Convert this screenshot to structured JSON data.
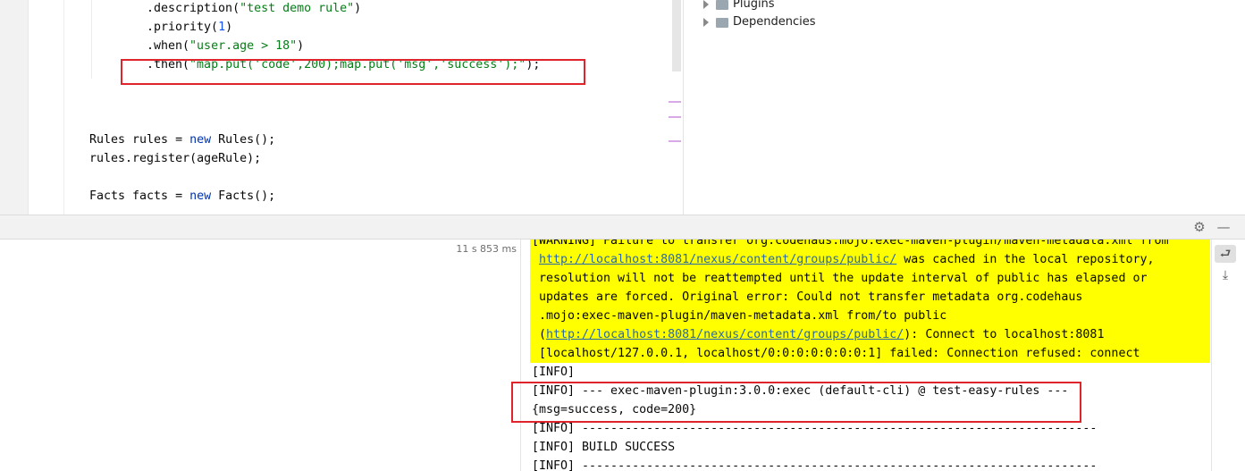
{
  "editor": {
    "lines": [
      {
        "parts": [
          {
            "t": ".description(",
            "c": ""
          },
          {
            "t": "\"test demo rule\"",
            "c": "str"
          },
          {
            "t": ")",
            "c": ""
          }
        ]
      },
      {
        "parts": [
          {
            "t": ".priority(",
            "c": ""
          },
          {
            "t": "1",
            "c": "num"
          },
          {
            "t": ")",
            "c": ""
          }
        ]
      },
      {
        "parts": [
          {
            "t": ".when(",
            "c": ""
          },
          {
            "t": "\"user.age > 18\"",
            "c": "str"
          },
          {
            "t": ")",
            "c": ""
          }
        ]
      },
      {
        "parts": [
          {
            "t": ".then(",
            "c": ""
          },
          {
            "t": "\"map.put('code',200);map.put('msg','success');\"",
            "c": "str"
          },
          {
            "t": ");",
            "c": ""
          }
        ]
      },
      {
        "parts": [
          {
            "t": "Rules rules = ",
            "c": ""
          },
          {
            "t": "new",
            "c": "kw"
          },
          {
            "t": " Rules();",
            "c": ""
          }
        ]
      },
      {
        "parts": [
          {
            "t": "rules.register(ageRule);",
            "c": ""
          }
        ]
      },
      {
        "parts": [
          {
            "t": "Facts facts = ",
            "c": ""
          },
          {
            "t": "new",
            "c": "kw"
          },
          {
            "t": " Facts();",
            "c": ""
          }
        ]
      }
    ]
  },
  "project_tree": {
    "items": [
      {
        "label": "Plugins",
        "icon": "plugins-folder-icon"
      },
      {
        "label": "Dependencies",
        "icon": "dependencies-folder-icon"
      }
    ]
  },
  "run": {
    "duration": "11 s 853 ms"
  },
  "console": {
    "warning_lines": [
      [
        {
          "t": "[WARNING] Failure to transfer org.codehaus.mojo:exec-maven-plugin/maven-metadata.xml from",
          "c": ""
        }
      ],
      [
        {
          "t": "http://localhost:8081/nexus/content/groups/public/",
          "c": "link"
        },
        {
          "t": " was cached in the local repository,",
          "c": ""
        }
      ],
      [
        {
          "t": "resolution will not be reattempted until the update interval of public has elapsed or",
          "c": ""
        }
      ],
      [
        {
          "t": "updates are forced. Original error: Could not transfer metadata org.codehaus",
          "c": ""
        }
      ],
      [
        {
          "t": ".mojo:exec-maven-plugin/maven-metadata.xml from/to public",
          "c": ""
        }
      ],
      [
        {
          "t": "(",
          "c": ""
        },
        {
          "t": "http://localhost:8081/nexus/content/groups/public/",
          "c": "link"
        },
        {
          "t": "): Connect to localhost:8081",
          "c": ""
        }
      ],
      [
        {
          "t": "[localhost/127.0.0.1, localhost/0:0:0:0:0:0:0:1] failed: Connection refused: connect",
          "c": ""
        }
      ]
    ],
    "info_lines": [
      "[INFO]",
      "[INFO] --- exec-maven-plugin:3.0.0:exec (default-cli) @ test-easy-rules ---",
      "{msg=success, code=200}",
      "[INFO] ------------------------------------------------------------------------",
      "[INFO] BUILD SUCCESS",
      "[INFO] ------------------------------------------------------------------------"
    ]
  },
  "colors": {
    "highlight_box": "#e0242b",
    "warning_bg": "#ffff00",
    "string": "#067d17",
    "keyword": "#0033b3",
    "number": "#1750eb"
  }
}
